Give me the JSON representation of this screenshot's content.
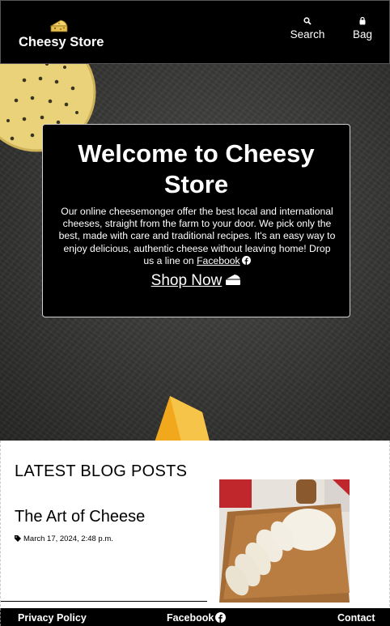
{
  "header": {
    "logo_text": "Cheesy Store",
    "logo_icon": "cheese-icon",
    "nav": {
      "search_label": "Search",
      "search_icon": "search-icon",
      "bag_label": "Bag",
      "bag_icon": "bag-icon"
    }
  },
  "hero": {
    "title": "Welcome to Cheesy Store",
    "text": "Our online cheesemonger offer the best local and international cheeses, straight from the farm to your door. We pick only the best, made with care and traditional recipes. It's an easy way to enjoy delicious, authentic cheese without leaving home! Drop us a line on",
    "facebook_link": "Facebook",
    "facebook_icon": "facebook-icon",
    "cta_label": "Shop Now",
    "cta_icon": "cheese-slice-icon"
  },
  "blog": {
    "heading": "LATEST BLOG POSTS",
    "post": {
      "title": "The Art of Cheese",
      "date": "March 17, 2024, 2:48 p.m.",
      "date_icon": "tag-icon"
    }
  },
  "footer": {
    "privacy": "Privacy Policy",
    "facebook": "Facebook",
    "contact": "Contact"
  },
  "colors": {
    "header_bg": "#000000",
    "card_bg": "#000000",
    "text_light": "#ffffff"
  }
}
